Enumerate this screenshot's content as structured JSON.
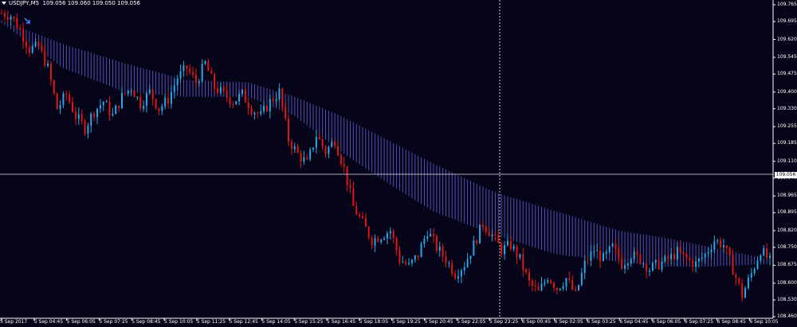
{
  "header": {
    "symbol": "USDJPY,M5",
    "ohlc": "109.056 109.060 109.050 109.056"
  },
  "current_price_label": "109.056",
  "colors": {
    "background": "#050418",
    "bull": "#29a8e8",
    "bear": "#e21616",
    "band": "#5a5ac8",
    "grid": "#e6e6e6"
  },
  "icons": [
    "arrow-down-right-icon",
    "dropdown-triangle-icon"
  ],
  "chart_data": {
    "type": "candlestick",
    "y_ticks": [
      "109.765",
      "109.695",
      "109.620",
      "109.545",
      "109.475",
      "109.400",
      "109.330",
      "109.255",
      "109.185",
      "109.110",
      "109.040",
      "108.965",
      "108.895",
      "108.820",
      "108.750",
      "108.675",
      "108.600",
      "108.530",
      "108.460"
    ],
    "x_ticks": [
      "5 Sep 2017",
      "5 Sep 04:45",
      "5 Sep 06:05",
      "5 Sep 07:25",
      "5 Sep 08:45",
      "5 Sep 10:05",
      "5 Sep 11:25",
      "5 Sep 12:45",
      "5 Sep 14:05",
      "5 Sep 15:25",
      "5 Sep 16:45",
      "5 Sep 18:05",
      "5 Sep 19:25",
      "5 Sep 20:45",
      "5 Sep 22:05",
      "5 Sep 23:25",
      "6 Sep 00:45",
      "6 Sep 02:05",
      "6 Sep 03:25",
      "6 Sep 04:45",
      "6 Sep 06:05",
      "6 Sep 07:25",
      "6 Sep 08:45",
      "6 Sep 10:05"
    ],
    "ylim": [
      108.46,
      109.765
    ],
    "current_price": 109.056,
    "close_path": [
      [
        0,
        109.73
      ],
      [
        3,
        109.72
      ],
      [
        6,
        109.66
      ],
      [
        9,
        109.58
      ],
      [
        12,
        109.59
      ],
      [
        15,
        109.5
      ],
      [
        18,
        109.33
      ],
      [
        21,
        109.39
      ],
      [
        24,
        109.3
      ],
      [
        27,
        109.25
      ],
      [
        30,
        109.32
      ],
      [
        33,
        109.36
      ],
      [
        36,
        109.3
      ],
      [
        39,
        109.38
      ],
      [
        42,
        109.42
      ],
      [
        45,
        109.35
      ],
      [
        48,
        109.4
      ],
      [
        51,
        109.33
      ],
      [
        54,
        109.37
      ],
      [
        57,
        109.46
      ],
      [
        60,
        109.5
      ],
      [
        63,
        109.44
      ],
      [
        66,
        109.52
      ],
      [
        69,
        109.42
      ],
      [
        72,
        109.39
      ],
      [
        75,
        109.36
      ],
      [
        78,
        109.39
      ],
      [
        81,
        109.33
      ],
      [
        84,
        109.3
      ],
      [
        87,
        109.36
      ],
      [
        90,
        109.4
      ],
      [
        93,
        109.2
      ],
      [
        96,
        109.14
      ],
      [
        99,
        109.1
      ],
      [
        102,
        109.22
      ],
      [
        105,
        109.15
      ],
      [
        108,
        109.2
      ],
      [
        111,
        109.08
      ],
      [
        114,
        108.92
      ],
      [
        117,
        108.85
      ],
      [
        120,
        108.78
      ],
      [
        123,
        108.8
      ],
      [
        126,
        108.82
      ],
      [
        129,
        108.7
      ],
      [
        132,
        108.67
      ],
      [
        135,
        108.72
      ],
      [
        138,
        108.82
      ],
      [
        141,
        108.75
      ],
      [
        144,
        108.7
      ],
      [
        147,
        108.64
      ],
      [
        150,
        108.68
      ],
      [
        153,
        108.76
      ],
      [
        156,
        108.85
      ],
      [
        159,
        108.8
      ],
      [
        162,
        108.74
      ],
      [
        165,
        108.76
      ],
      [
        168,
        108.7
      ],
      [
        171,
        108.6
      ],
      [
        174,
        108.56
      ],
      [
        177,
        108.63
      ],
      [
        180,
        108.58
      ],
      [
        183,
        108.62
      ],
      [
        186,
        108.55
      ],
      [
        189,
        108.68
      ],
      [
        192,
        108.74
      ],
      [
        195,
        108.7
      ],
      [
        198,
        108.75
      ],
      [
        201,
        108.68
      ],
      [
        204,
        108.72
      ],
      [
        207,
        108.7
      ],
      [
        210,
        108.66
      ],
      [
        213,
        108.68
      ],
      [
        216,
        108.7
      ],
      [
        219,
        108.73
      ],
      [
        222,
        108.7
      ],
      [
        225,
        108.68
      ],
      [
        228,
        108.72
      ],
      [
        231,
        108.78
      ],
      [
        234,
        108.76
      ],
      [
        237,
        108.66
      ],
      [
        240,
        108.55
      ],
      [
        243,
        108.64
      ],
      [
        246,
        108.74
      ],
      [
        249,
        108.69
      ]
    ],
    "band_upper_path": [
      [
        0,
        109.7
      ],
      [
        20,
        109.6
      ],
      [
        40,
        109.52
      ],
      [
        60,
        109.45
      ],
      [
        80,
        109.44
      ],
      [
        95,
        109.38
      ],
      [
        110,
        109.3
      ],
      [
        125,
        109.2
      ],
      [
        140,
        109.1
      ],
      [
        160,
        108.98
      ],
      [
        180,
        108.9
      ],
      [
        200,
        108.82
      ],
      [
        215,
        108.79
      ],
      [
        230,
        108.75
      ],
      [
        249,
        108.7
      ]
    ],
    "band_lower_path": [
      [
        0,
        109.69
      ],
      [
        20,
        109.5
      ],
      [
        40,
        109.4
      ],
      [
        60,
        109.38
      ],
      [
        80,
        109.38
      ],
      [
        95,
        109.3
      ],
      [
        110,
        109.15
      ],
      [
        125,
        109.02
      ],
      [
        140,
        108.9
      ],
      [
        160,
        108.8
      ],
      [
        180,
        108.72
      ],
      [
        200,
        108.69
      ],
      [
        215,
        108.67
      ],
      [
        230,
        108.67
      ],
      [
        249,
        108.68
      ]
    ]
  }
}
